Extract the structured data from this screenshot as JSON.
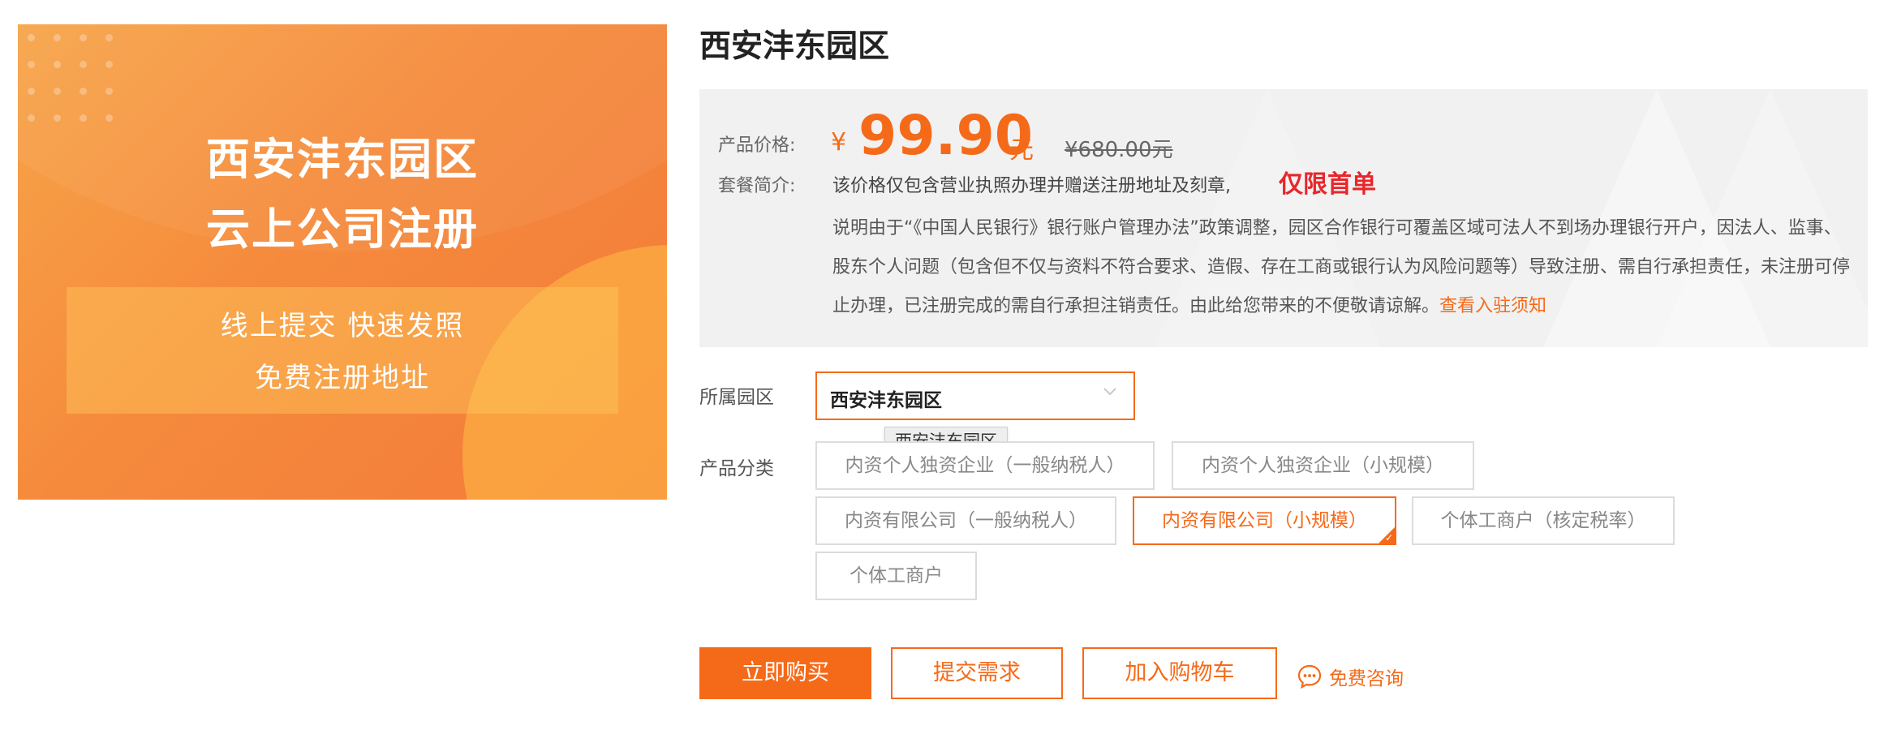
{
  "banner": {
    "title_line1": "西安沣东园区",
    "title_line2": "云上公司注册",
    "sub_line1": "线上提交 快速发照",
    "sub_line2": "免费注册地址"
  },
  "product": {
    "title": "西安沣东园区",
    "price_label": "产品价格:",
    "currency": "¥",
    "price": "99.90",
    "price_unit": "元",
    "original_price": "¥680.00元",
    "intro_label": "套餐简介:",
    "intro_text": "该价格仅包含营业执照办理并赠送注册地址及刻章,",
    "intro_highlight": "仅限首单",
    "notice_text": "说明由于“《中国人民银行》银行账户管理办法”政策调整，园区合作银行可覆盖区域可法人不到场办理银行开户，因法人、监事、股东个人问题（包含但不仅与资料不符合要求、造假、存在工商或银行认为风险问题等）导致注册、需自行承担责任，未注册可停止办理，已注册完成的需自行承担注销责任。由此给您带来的不便敬请谅解。",
    "notice_link": "查看入驻须知"
  },
  "park": {
    "label": "所属园区",
    "selected": "西安沣东园区",
    "tooltip": "西安沣东园区"
  },
  "category": {
    "label": "产品分类",
    "options": [
      "内资个人独资企业（一般纳税人）",
      "内资个人独资企业（小规模）",
      "内资有限公司（一般纳税人）",
      "内资有限公司（小规模）",
      "个体工商户（核定税率）",
      "个体工商户"
    ],
    "selected_index": 3
  },
  "actions": {
    "buy": "立即购买",
    "submit": "提交需求",
    "cart": "加入购物车",
    "consult": "免费咨询"
  },
  "colors": {
    "accent": "#f56a19",
    "highlight": "#e8262b"
  }
}
